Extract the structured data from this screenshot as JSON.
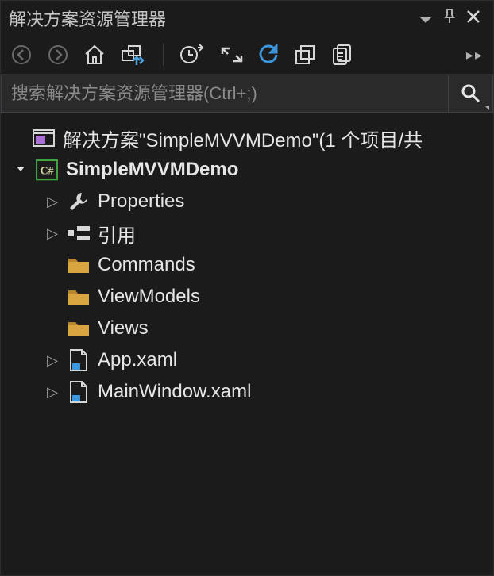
{
  "panel": {
    "title": "解决方案资源管理器"
  },
  "search": {
    "placeholder": "搜索解决方案资源管理器(Ctrl+;)"
  },
  "tree": {
    "solution_label": "解决方案\"SimpleMVVMDemo\"(1 个项目/共",
    "project": {
      "label": "SimpleMVVMDemo",
      "children": [
        {
          "type": "properties",
          "label": "Properties",
          "expandable": true
        },
        {
          "type": "references",
          "label": "引用",
          "expandable": true
        },
        {
          "type": "folder",
          "label": "Commands",
          "expandable": false
        },
        {
          "type": "folder",
          "label": "ViewModels",
          "expandable": false
        },
        {
          "type": "folder",
          "label": "Views",
          "expandable": false
        },
        {
          "type": "xaml",
          "label": "App.xaml",
          "expandable": true
        },
        {
          "type": "xaml",
          "label": "MainWindow.xaml",
          "expandable": true
        }
      ]
    }
  }
}
